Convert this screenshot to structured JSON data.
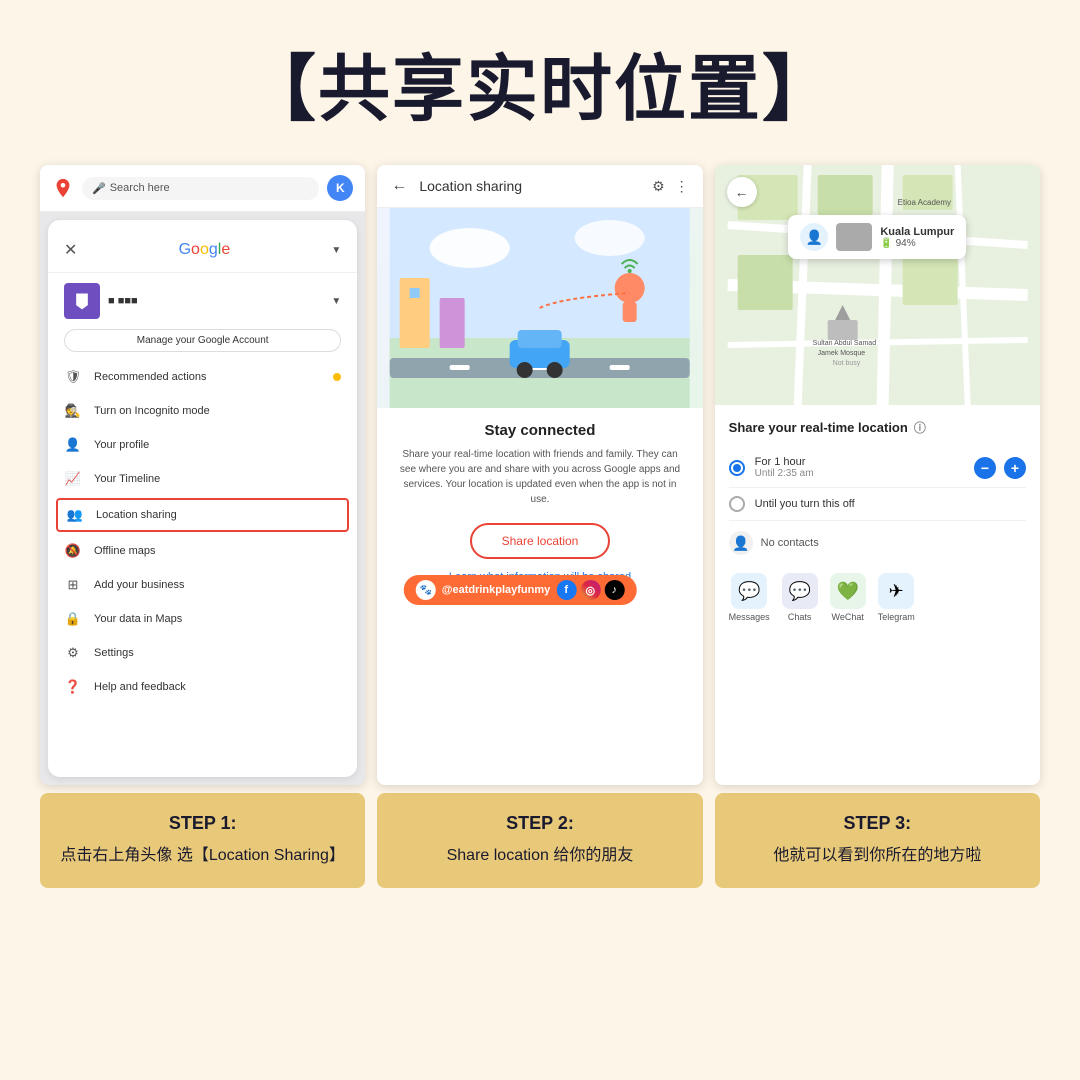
{
  "page": {
    "background_color": "#fdf6e8",
    "title": "【共享实时位置】"
  },
  "header": {
    "title": "【共享实时位置】"
  },
  "screenshots": {
    "screen1": {
      "search_placeholder": "Search here",
      "google_text": "Google",
      "manage_btn": "Manage your Google Account",
      "menu_items": [
        {
          "label": "Recommended actions",
          "has_warning": true
        },
        {
          "label": "Turn on Incognito mode"
        },
        {
          "label": "Your profile"
        },
        {
          "label": "Your Timeline"
        },
        {
          "label": "Location sharing",
          "highlighted": true
        },
        {
          "label": "Offline maps"
        },
        {
          "label": "Add your business"
        },
        {
          "label": "Your data in Maps"
        },
        {
          "label": "Settings"
        },
        {
          "label": "Help and feedback"
        }
      ]
    },
    "screen2": {
      "header_title": "Location sharing",
      "illustration_alt": "Stay connected illustration",
      "stay_connected": "Stay connected",
      "description": "Share your real-time location with friends and family.\n\nThey can see where you are and share with you across Google apps and services. Your location is updated even when the app is not in use.",
      "share_btn": "Share location",
      "learn_link": "Learn what information will be shared"
    },
    "screen3": {
      "location_name": "Kuala Lumpur",
      "battery": "94%",
      "realtime_title": "Share your real-time location",
      "option1_main": "For 1 hour",
      "option1_sub": "Until 2:35 am",
      "option2_main": "Until you turn this off",
      "no_contacts": "No contacts",
      "apps": [
        {
          "label": "Messages"
        },
        {
          "label": "Chats"
        },
        {
          "label": "WeChat"
        },
        {
          "label": "Telegram"
        }
      ]
    }
  },
  "watermark": {
    "text": "@eatdrinkplayfunmy"
  },
  "steps": [
    {
      "title": "STEP 1:",
      "desc": "点击右上角头像 选【Location Sharing】"
    },
    {
      "title": "STEP 2:",
      "desc": "Share location 给你的朋友"
    },
    {
      "title": "STEP 3:",
      "desc": "他就可以看到你所在的地方啦"
    }
  ]
}
